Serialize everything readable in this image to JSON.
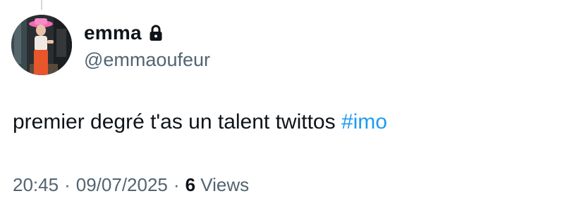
{
  "tweet": {
    "author": {
      "display_name": "emma",
      "handle": "@emmaoufeur",
      "protected": true
    },
    "text": "premier degré t'as un talent twittos ",
    "hashtag": "#imo",
    "time": "20:45",
    "separator": "·",
    "date": "09/07/2025",
    "views_count": "6",
    "views_label": "Views"
  },
  "colors": {
    "text_primary": "#0f1419",
    "text_secondary": "#536471",
    "link": "#1d9bf0"
  },
  "icons": {
    "protected": "lock-icon"
  }
}
